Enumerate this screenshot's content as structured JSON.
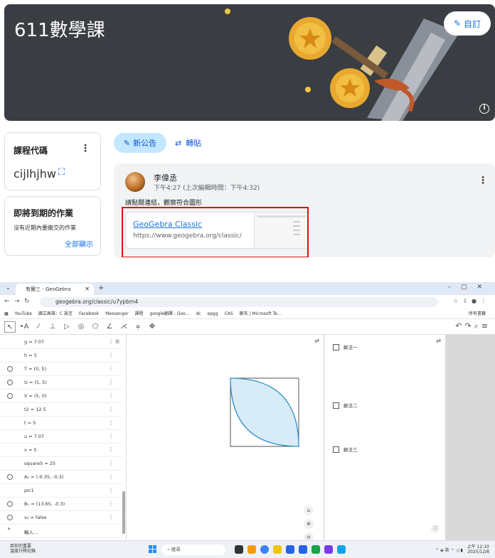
{
  "classroom": {
    "class_title": "611數學課",
    "edit_label": "自訂",
    "code_card": {
      "title": "課程代碼",
      "code": "cijlhjhw"
    },
    "due_card": {
      "title": "即將到期的作業",
      "text": "沒有近期內要繳交的作業",
      "view_all": "全部顯示"
    },
    "announce_label": "新公告",
    "repost_label": "轉貼",
    "post": {
      "author": "李偉丞",
      "time": "下午4:27 (上次編輯時間：下午4:32)",
      "text": "請點閱連結，觀察符合圖形",
      "link_title": "GeoGebra Classic",
      "link_url": "https://www.geogebra.org/classic/"
    },
    "colors": {
      "banner": "#3a3d42",
      "accent": "#1a73e8",
      "highlight": "#dd1111"
    }
  },
  "browser": {
    "tab_title": "有爾三 - GeoGebra",
    "url": "geogebra.org/classic/u7ypbrn4",
    "bookmarks": [
      "YouTube",
      "國立高雄：C 語言",
      "Facebook",
      "Messenger",
      "課程",
      "google翻譯 - Goo...",
      "dc",
      "epgg",
      "CAS",
      "聊天 | Microsoft Te..."
    ],
    "bookmarks_right": "所有書籤"
  },
  "algebra_rows": [
    {
      "text": "g = 7.07",
      "radio": false
    },
    {
      "text": "h = 5",
      "radio": false
    },
    {
      "text": "T = (0, 5)",
      "radio": true
    },
    {
      "text": "U = (5, 5)",
      "radio": true
    },
    {
      "text": "V = (5, 0)",
      "radio": true
    },
    {
      "text": "t2 = 12.5",
      "radio": false
    },
    {
      "text": "t = 5",
      "radio": false
    },
    {
      "text": "u = 7.07",
      "radio": false
    },
    {
      "text": "v = 5",
      "radio": false
    },
    {
      "text": "square5 = 25",
      "radio": false
    },
    {
      "text": "A₁ = (-0.35, -0.3)",
      "radio": true
    },
    {
      "text": "pic1",
      "radio": false
    },
    {
      "text": "B₁ = (13.65, -0.3)",
      "radio": true
    },
    {
      "text": "v₄ = false",
      "radio": true
    },
    {
      "text": "輸入...",
      "radio": false
    }
  ],
  "checkboxes": [
    "解法一",
    "解法二",
    "解法三"
  ],
  "taskbar": {
    "weather_line1": "目前的重要",
    "weather_line2": "溫度升降記錄",
    "search": "搜尋",
    "time": "上午 12:10",
    "date": "2025/12/8"
  }
}
